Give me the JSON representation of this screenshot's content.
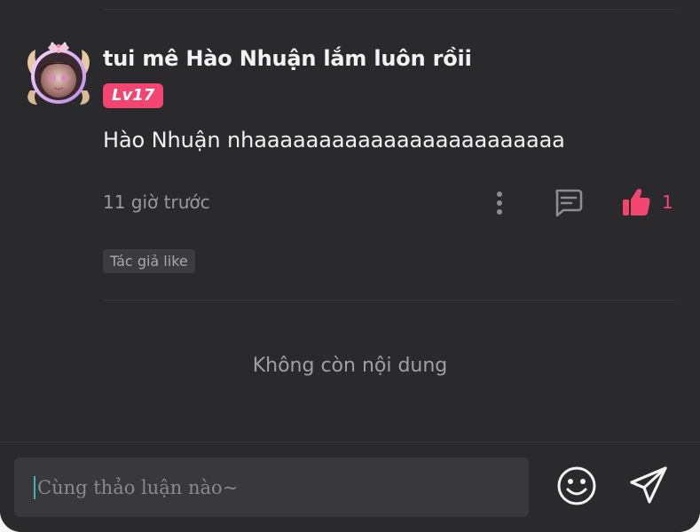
{
  "comment": {
    "username": "tui mê Hào Nhuận lắm luôn rồii",
    "level_badge": "Lv17",
    "text": "Hào Nhuận nhaaaaaaaaaaaaaaaaaaaaaaaa",
    "timestamp": "11 giờ trước",
    "like_count": "1",
    "author_like_tag": "Tác giả like"
  },
  "footer": {
    "end_message": "Không còn nội dung"
  },
  "composer": {
    "placeholder": "Cùng thảo luận nào~"
  },
  "icons": {
    "avatar": "avatar-with-crown-frame",
    "more": "more-vertical-icon",
    "reply": "comment-icon",
    "like": "thumbs-up-icon",
    "emoji": "smiley-icon",
    "send": "send-icon"
  },
  "colors": {
    "background": "#2a2a2c",
    "accent": "#f2456f",
    "muted_text": "#9a9a9c",
    "caret": "#3db8a8"
  }
}
